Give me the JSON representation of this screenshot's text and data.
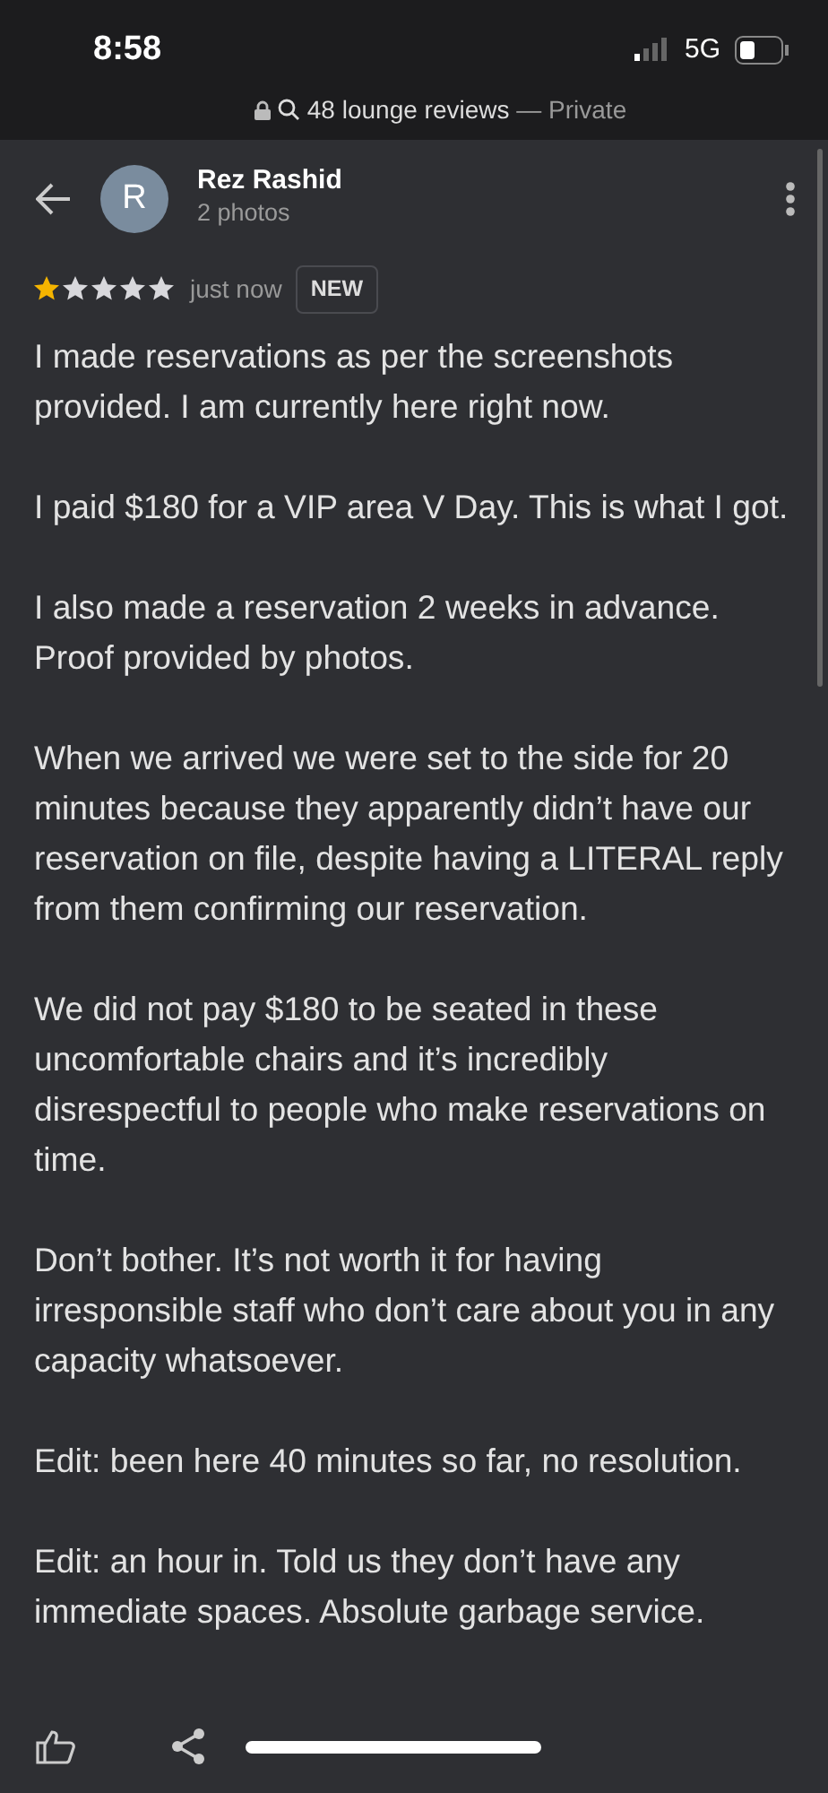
{
  "status_bar": {
    "time": "8:58",
    "network": "5G"
  },
  "address_bar": {
    "title": "48 lounge reviews",
    "separator": "—",
    "mode": "Private"
  },
  "reviewer": {
    "initial": "R",
    "name": "Rez Rashid",
    "photos": "2 photos"
  },
  "review": {
    "stars": 1,
    "time": "just now",
    "badge": "NEW",
    "paragraphs": [
      "I made reservations as per the screenshots provided. I am currently here right now.",
      "I paid $180 for a VIP area V Day. This is what I got.",
      "I also made a reservation 2 weeks in advance. Proof provided by photos.",
      "When we arrived we were set to the side for 20 minutes because they apparently didn’t have our reservation on file, despite having a LITERAL reply from them confirming our reservation.",
      "We did not pay $180 to be seated in these uncomfortable chairs and it’s incredibly disrespectful to people who make reservations on time.",
      "Don’t bother. It’s not worth it for having irresponsible staff who don’t care about you in any capacity whatsoever.",
      "Edit: been here 40 minutes so far, no resolution.",
      "Edit: an hour in. Told us they don’t have any immediate spaces. Absolute garbage service."
    ]
  }
}
